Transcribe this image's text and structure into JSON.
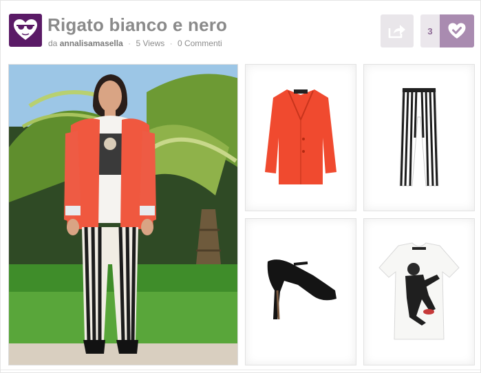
{
  "post": {
    "title": "Rigato bianco e nero",
    "by_prefix": "da",
    "author": "annalisamasella",
    "views": "5 Views",
    "comments": "0 Commenti",
    "separator": "·"
  },
  "actions": {
    "like_count": "3",
    "share_icon": "share-icon",
    "like_icon": "heart-check-icon"
  },
  "logo": {
    "icon": "heart-sunglasses-icon"
  },
  "gallery": {
    "main_image": "outfit-photo",
    "items": [
      {
        "name": "red-blazer-image"
      },
      {
        "name": "striped-pants-image"
      },
      {
        "name": "black-heels-image"
      },
      {
        "name": "graphic-tshirt-image"
      }
    ]
  },
  "colors": {
    "brand": "#5a1a66",
    "accent": "#a98bb0",
    "title": "#8a8a8a"
  }
}
